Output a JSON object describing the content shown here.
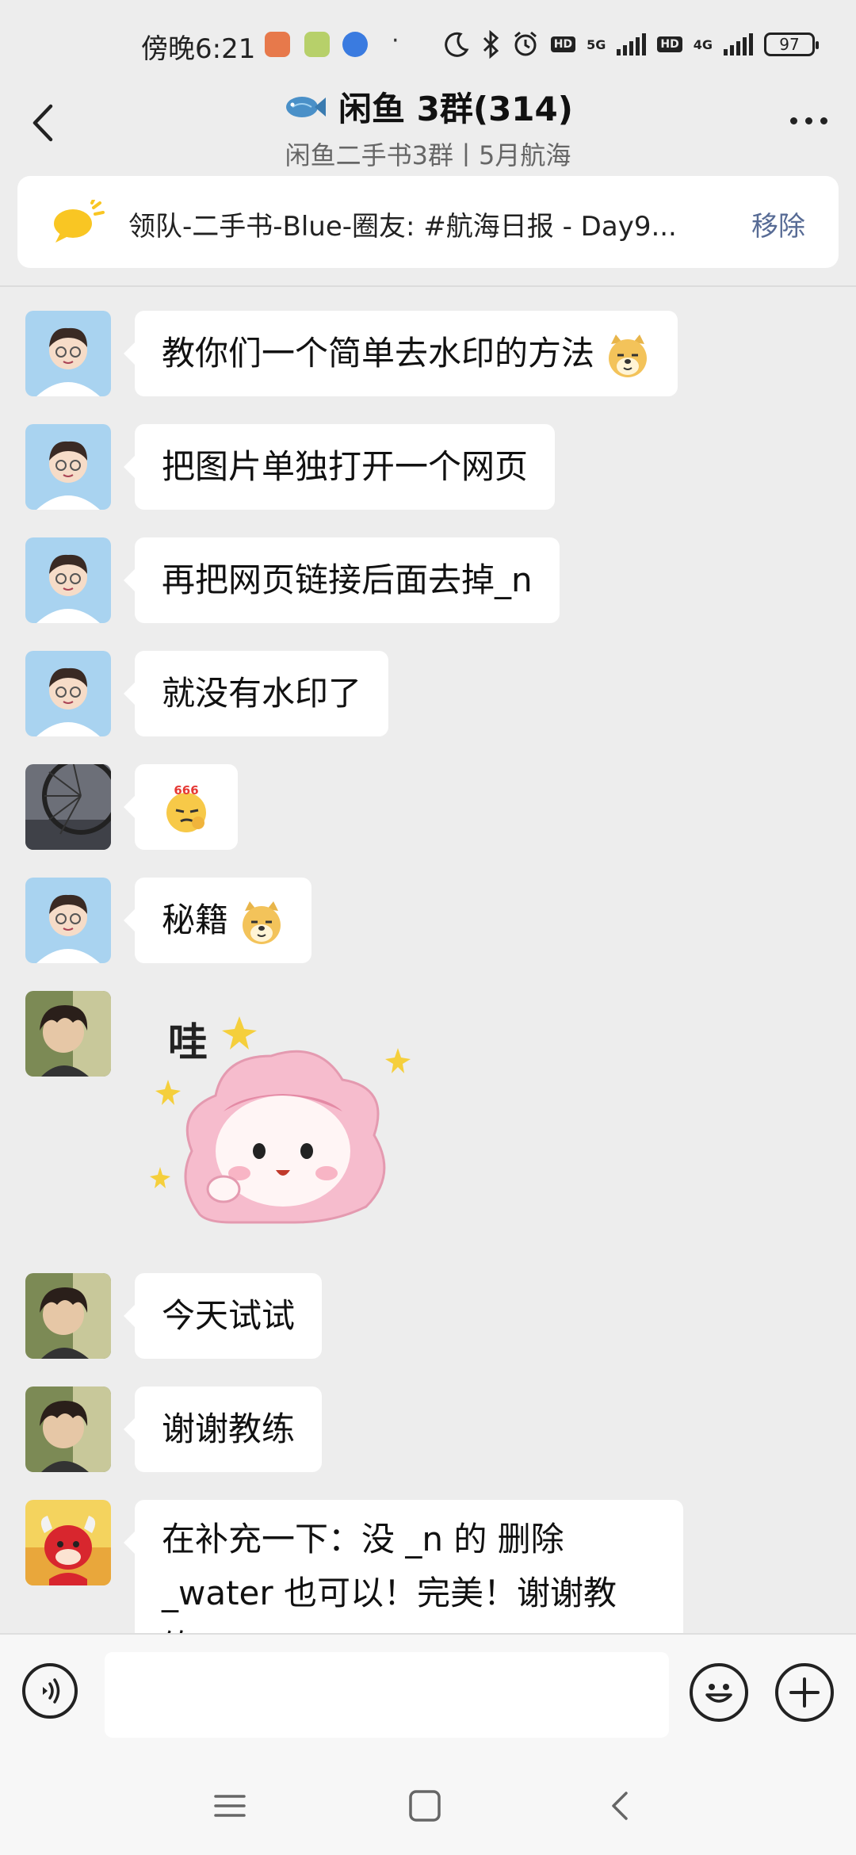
{
  "status_bar": {
    "time": "傍晚6:21",
    "net_5g": "5G",
    "net_4g": "4G",
    "hd": "HD",
    "battery": "97"
  },
  "header": {
    "title": "闲鱼 3群(314)",
    "subtitle": "闲鱼二手书3群丨5月航海"
  },
  "notice": {
    "text": "领队-二手书-Blue-圈友: #航海日报 - Day9...",
    "remove_label": "移除"
  },
  "messages": [
    {
      "sender": "user-1",
      "text": "教你们一个简单去水印的方法",
      "emoji": "doge-emoji"
    },
    {
      "sender": "user-1",
      "text": "把图片单独打开一个网页"
    },
    {
      "sender": "user-1",
      "text": "再把网页链接后面去掉_n"
    },
    {
      "sender": "user-1",
      "text": "就没有水印了"
    },
    {
      "sender": "user-2",
      "emoji": "666-emoji",
      "emoji_text": "666"
    },
    {
      "sender": "user-1",
      "text": "秘籍",
      "emoji": "doge-emoji"
    },
    {
      "sender": "user-3",
      "sticker": "wow-sticker",
      "sticker_text": "哇"
    },
    {
      "sender": "user-3",
      "text": "今天试试"
    },
    {
      "sender": "user-3",
      "text": "谢谢教练"
    },
    {
      "sender": "user-4",
      "text": "在补充一下：没 _n 的 删除 _water 也可以！完美！谢谢教练！"
    }
  ],
  "input": {
    "placeholder": ""
  },
  "colors": {
    "background": "#ededed",
    "bubble": "#ffffff",
    "link": "#576b95"
  }
}
